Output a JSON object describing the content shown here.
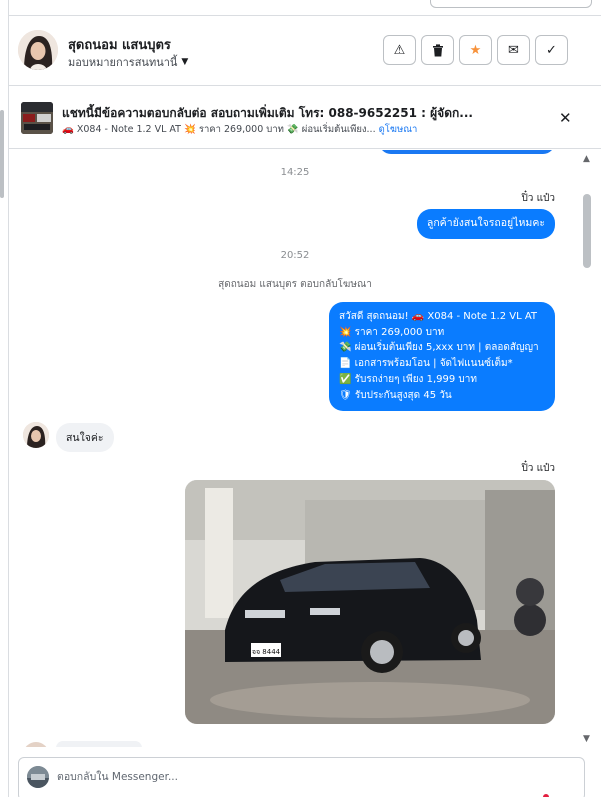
{
  "contact": {
    "name": "สุดถนอม แสนบุตร",
    "assign_label": "มอบหมายการสนทนานี้"
  },
  "header_actions": [
    {
      "icon": "warning-icon",
      "glyph": "⚠"
    },
    {
      "icon": "trash-icon",
      "glyph": "🗑"
    },
    {
      "icon": "star-icon",
      "glyph": "★",
      "color": "#f7923b"
    },
    {
      "icon": "envelope-icon",
      "glyph": "✉"
    },
    {
      "icon": "check-icon",
      "glyph": "✓"
    }
  ],
  "ad_banner": {
    "title": "แชทนี้มีข้อความตอบกลับต่อ สอบถามเพิ่มเติม โทร: 088-9652251 : ผู้จัดก...",
    "subtitle": "🚗 X084 - Note 1.2 VL AT 💥 ราคา 269,000 บาท 💸 ผ่อนเริ่มต้นเพียง...",
    "link": "ดูโฆษณา",
    "close": "✕"
  },
  "thread": {
    "time1": "14:25",
    "sender1": "ปิ๋ว แป๋ว",
    "msg1": "ลูกค้ายังสนใจรถอยู่ไหมคะ",
    "time2": "20:52",
    "reply_note": "สุดถนอม แสนบุตร ตอบกลับโฆษณา",
    "promo": {
      "line1": "สวัสดี สุดถนอม! 🚗 X084 - Note 1.2 VL AT",
      "line2": "💥 ราคา 269,000 บาท",
      "line3": "💸 ผ่อนเริ่มต้นเพียง 5,xxx บาท | ตลอดสัญญา",
      "line4": "📄 เอกสารพร้อมโอน | จัดไฟแนนซ์เต็ม*",
      "line5": "✅ รับรถง่ายๆ เพียง 1,999 บาท",
      "line6": "🛡 รับประกันสูงสุด 45 วัน"
    },
    "incoming": "สนใจค่ะ",
    "sender2": "ปิ๋ว แป๋ว",
    "plate": "จจ 8444"
  },
  "composer": {
    "placeholder": "ตอบกลับใน Messenger..."
  },
  "colors": {
    "accent_blue": "#0a7cff",
    "star": "#f7923b"
  }
}
